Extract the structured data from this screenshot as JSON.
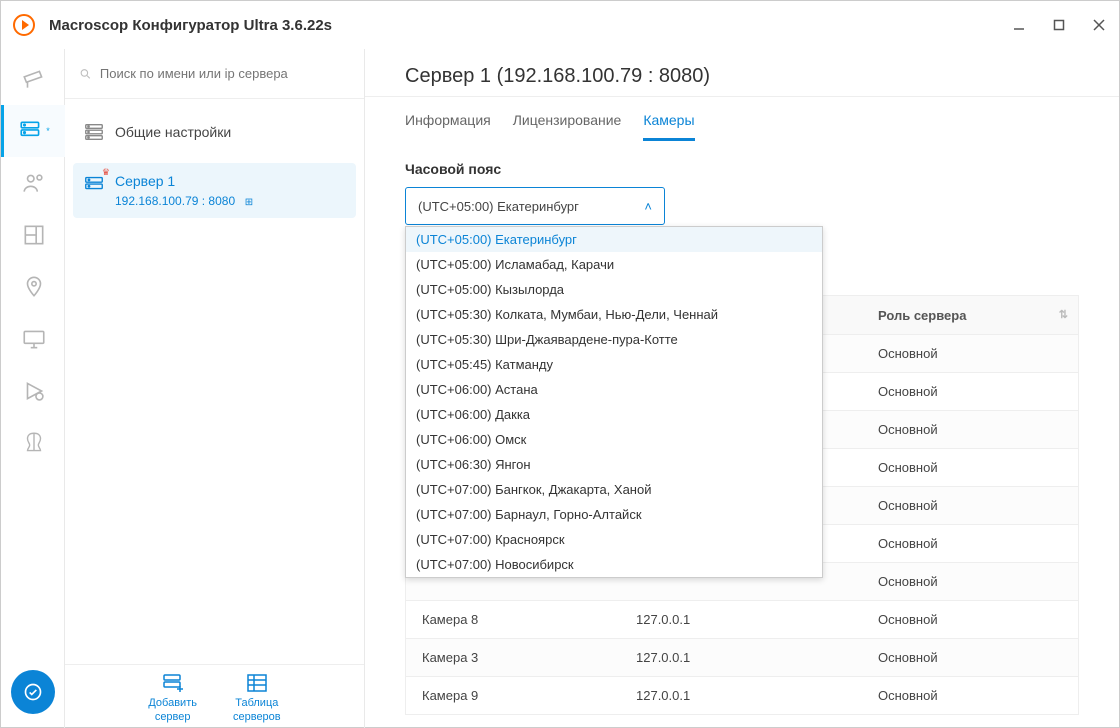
{
  "app": {
    "title": "Macroscop Конфигуратор Ultra 3.6.22s"
  },
  "search": {
    "placeholder": "Поиск по имени или ip сервера"
  },
  "tree": {
    "general_label": "Общие настройки",
    "server_name": "Сервер 1",
    "server_addr": "192.168.100.79 : 8080"
  },
  "bottom": {
    "add_server_line1": "Добавить",
    "add_server_line2": "сервер",
    "server_table_line1": "Таблица",
    "server_table_line2": "серверов"
  },
  "header": {
    "title": "Сервер 1 (192.168.100.79 : 8080)"
  },
  "tabs": {
    "info": "Информация",
    "licensing": "Лицензирование",
    "cameras": "Камеры"
  },
  "timezone": {
    "label": "Часовой пояс",
    "selected": "(UTC+05:00) Екатеринбург",
    "options": [
      "(UTC+05:00) Екатеринбург",
      "(UTC+05:00) Исламабад, Карачи",
      "(UTC+05:00) Кызылорда",
      "(UTC+05:30) Колката, Мумбаи, Нью-Дели, Ченнай",
      "(UTC+05:30) Шри-Джаявардене-пура-Котте",
      "(UTC+05:45) Катманду",
      "(UTC+06:00) Астана",
      "(UTC+06:00) Дакка",
      "(UTC+06:00) Омск",
      "(UTC+06:30) Янгон",
      "(UTC+07:00) Бангкок, Джакарта, Ханой",
      "(UTC+07:00) Барнаул, Горно-Алтайск",
      "(UTC+07:00) Красноярск",
      "(UTC+07:00) Новосибирск"
    ]
  },
  "table": {
    "col_role": "Роль сервера",
    "rows": [
      {
        "name": "",
        "ip": "",
        "role": "Основной"
      },
      {
        "name": "",
        "ip": "",
        "role": "Основной"
      },
      {
        "name": "",
        "ip": "",
        "role": "Основной"
      },
      {
        "name": "",
        "ip": "",
        "role": "Основной"
      },
      {
        "name": "",
        "ip": "",
        "role": "Основной"
      },
      {
        "name": "",
        "ip": "",
        "role": "Основной"
      },
      {
        "name": "",
        "ip": "",
        "role": "Основной"
      },
      {
        "name": "Камера 8",
        "ip": "127.0.0.1",
        "role": "Основной"
      },
      {
        "name": "Камера 3",
        "ip": "127.0.0.1",
        "role": "Основной"
      },
      {
        "name": "Камера 9",
        "ip": "127.0.0.1",
        "role": "Основной"
      }
    ]
  }
}
